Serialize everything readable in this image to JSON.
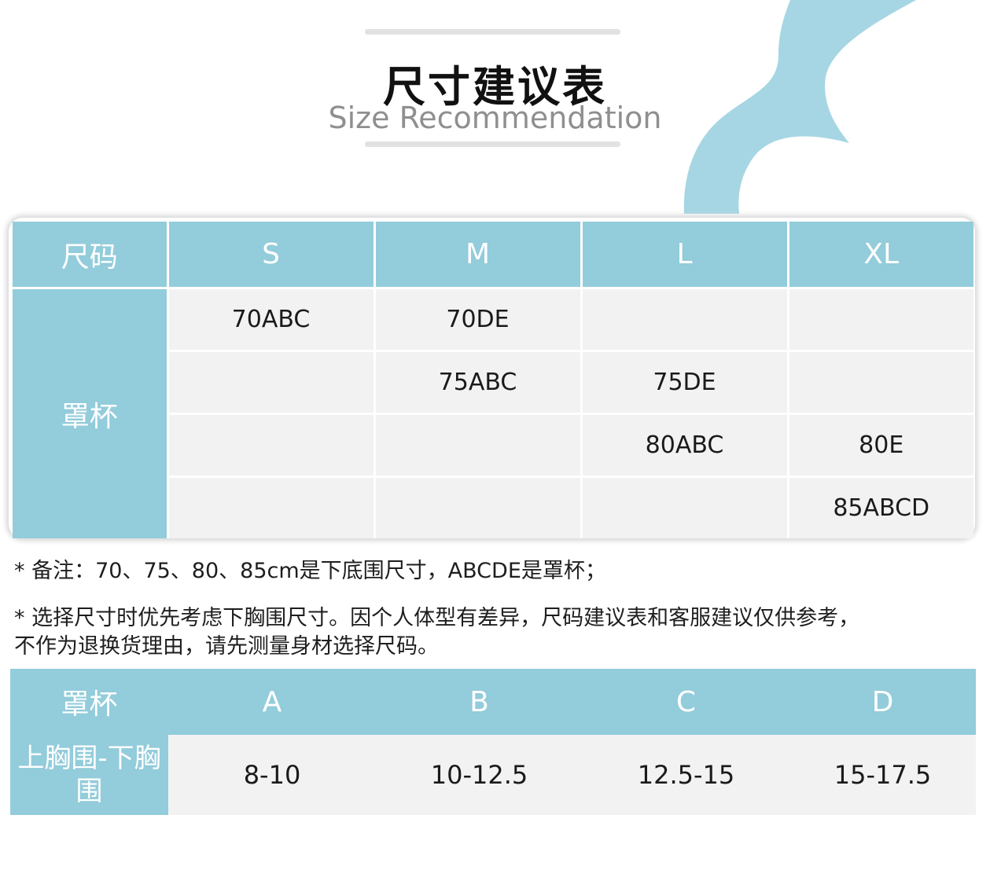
{
  "header": {
    "title_cn": "尺寸建议表",
    "title_en": "Size Recommendation"
  },
  "size_table": {
    "corner_label": "尺码",
    "row_label": "罩杯",
    "columns": [
      "S",
      "M",
      "L",
      "XL"
    ],
    "rows": [
      [
        "70ABC",
        "70DE",
        "",
        ""
      ],
      [
        "",
        "75ABC",
        "75DE",
        ""
      ],
      [
        "",
        "",
        "80ABC",
        "80E"
      ],
      [
        "",
        "",
        "",
        "85ABCD"
      ]
    ]
  },
  "notes": {
    "note1": "* 备注：70、75、80、85cm是下底围尺寸，ABCDE是罩杯；",
    "note2_line1": "* 选择尺寸时优先考虑下胸围尺寸。因个人体型有差异，尺码建议表和客服建议仅供参考，",
    "note2_line2": "不作为退换货理由，请先测量身材选择尺码。"
  },
  "cup_table": {
    "header_label": "罩杯",
    "row_label": "上胸围-下胸围",
    "cups": [
      "A",
      "B",
      "C",
      "D"
    ],
    "values": [
      "8-10",
      "10-12.5",
      "12.5-15",
      "15-17.5"
    ]
  },
  "colors": {
    "accent_blue": "#93ccdb",
    "cell_gray": "#f2f2f2",
    "subtitle_gray": "#8f8f8f"
  }
}
